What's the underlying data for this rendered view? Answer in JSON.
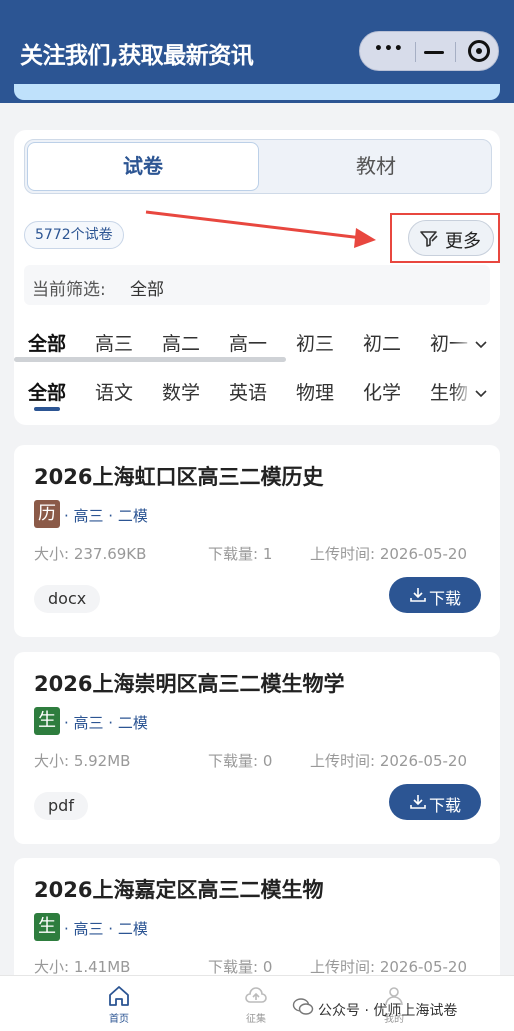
{
  "header": {
    "title": "关注我们,获取最新资讯"
  },
  "filter": {
    "segments": {
      "active": "试卷",
      "inactive": "教材"
    },
    "count_badge": "5772个试卷",
    "more_label": "更多",
    "current_label": "当前筛选:",
    "current_value": "全部",
    "grades": [
      "全部",
      "高三",
      "高二",
      "高一",
      "初三",
      "初二",
      "初一"
    ],
    "subjects": [
      "全部",
      "语文",
      "数学",
      "英语",
      "物理",
      "化学",
      "生物"
    ]
  },
  "papers": [
    {
      "title": "2026上海虹口区高三二模历史",
      "subject_badge": "历",
      "badge_color": "#8b5a48",
      "tags": "· 高三 · 二模",
      "size": "大小: 237.69KB",
      "downloads": "下载量: 1",
      "uploaded": "上传时间: 2026-05-20",
      "format": "docx",
      "download_label": "下载"
    },
    {
      "title": "2026上海崇明区高三二模生物学",
      "subject_badge": "生",
      "badge_color": "#2e7d3e",
      "tags": "· 高三 · 二模",
      "size": "大小: 5.92MB",
      "downloads": "下载量: 0",
      "uploaded": "上传时间: 2026-05-20",
      "format": "pdf",
      "download_label": "下载"
    },
    {
      "title": "2026上海嘉定区高三二模生物",
      "subject_badge": "生",
      "badge_color": "#2e7d3e",
      "tags": "· 高三 · 二模",
      "size": "大小: 1.41MB",
      "downloads": "下载量: 0",
      "uploaded": "上传时间: 2026-05-20"
    }
  ],
  "nav": {
    "home": "首页",
    "collect": "征集",
    "mine": "我的"
  },
  "watermark": "公众号 · 优师上海试卷",
  "colors": {
    "primary": "#2c5593",
    "highlight": "#e8473f"
  }
}
